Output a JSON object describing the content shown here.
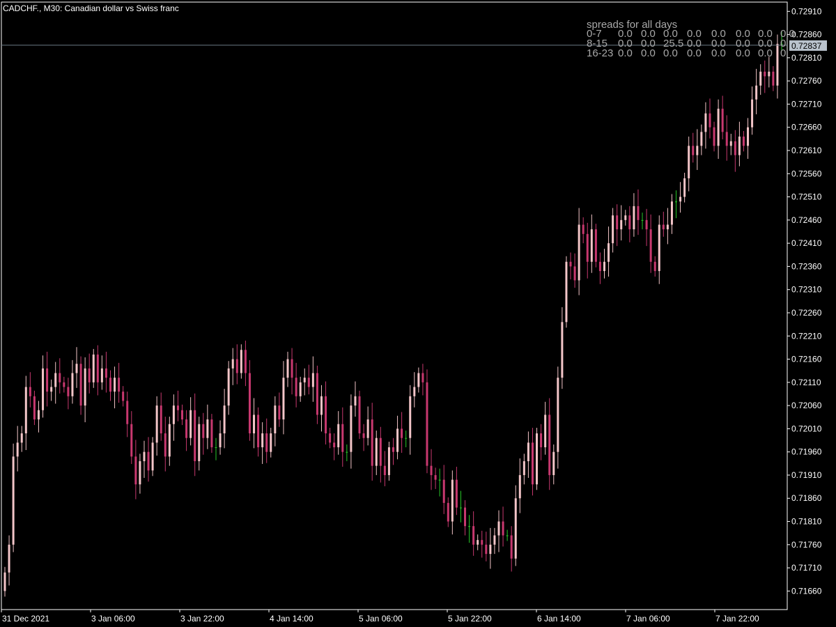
{
  "window": {
    "title": "CADCHF., M30:  Canadian dollar vs Swiss franc"
  },
  "colors": {
    "background": "#000000",
    "frame": "#ffffff",
    "bull": "#f3c5c8",
    "bear": "#c8386f",
    "neutral": "#28c828",
    "bid_line": "#6b7a86",
    "spread_text": "#a9a9a9",
    "badge_bg": "#b9c2cc"
  },
  "spreads": {
    "title": "spreads for all days",
    "rows": [
      {
        "label": "0-7",
        "values": [
          "0.0",
          "0.0",
          "0.0",
          "0.0",
          "0.0",
          "0.0",
          "0.0",
          "0.0"
        ]
      },
      {
        "label": "8-15",
        "values": [
          "0.0",
          "0.0",
          "25.5",
          "0.0",
          "0.0",
          "0.0",
          "0.0",
          "0"
        ]
      },
      {
        "label": "16-23",
        "values": [
          "0.0",
          "0.0",
          "0.0",
          "0.0",
          "0.0",
          "0.0",
          "0.0",
          "0"
        ]
      }
    ]
  },
  "current_price": "0.72837",
  "chart_data": {
    "type": "candlestick",
    "symbol": "CADCHF.",
    "timeframe": "M30",
    "ylim": [
      0.7162,
      0.7293
    ],
    "y_ticks": [
      "0.72910",
      "0.72860",
      "0.72810",
      "0.72760",
      "0.72710",
      "0.72660",
      "0.72610",
      "0.72560",
      "0.72510",
      "0.72460",
      "0.72410",
      "0.72360",
      "0.72310",
      "0.72260",
      "0.72210",
      "0.72160",
      "0.72110",
      "0.72060",
      "0.72010",
      "0.71960",
      "0.71910",
      "0.71860",
      "0.71810",
      "0.71760",
      "0.71710",
      "0.71660"
    ],
    "x_ticks": [
      "31 Dec 2021",
      "3 Jan 06:00",
      "3 Jan 22:00",
      "4 Jan 14:00",
      "5 Jan 06:00",
      "5 Jan 22:00",
      "6 Jan 14:00",
      "7 Jan 06:00",
      "7 Jan 22:00"
    ],
    "bid_line": 0.72837,
    "series": [
      {
        "name": "close",
        "values": [
          0.717,
          0.7176,
          0.7195,
          0.7198,
          0.72,
          0.721,
          0.7208,
          0.7203,
          0.7205,
          0.7214,
          0.7209,
          0.721,
          0.7213,
          0.7211,
          0.721,
          0.7208,
          0.7213,
          0.7215,
          0.7206,
          0.7214,
          0.7211,
          0.7217,
          0.7211,
          0.7214,
          0.7212,
          0.7209,
          0.7212,
          0.7209,
          0.7207,
          0.7202,
          0.7195,
          0.7189,
          0.7194,
          0.7196,
          0.7192,
          0.7198,
          0.7206,
          0.72,
          0.7195,
          0.7202,
          0.7206,
          0.7205,
          0.7203,
          0.7199,
          0.7205,
          0.7194,
          0.7202,
          0.7199,
          0.7203,
          0.7197,
          0.7197,
          0.72,
          0.7206,
          0.7214,
          0.7216,
          0.7213,
          0.7218,
          0.7213,
          0.72,
          0.7204,
          0.7197,
          0.72,
          0.7196,
          0.72,
          0.7206,
          0.7203,
          0.7212,
          0.7216,
          0.7212,
          0.7208,
          0.7211,
          0.7212,
          0.721,
          0.7213,
          0.7204,
          0.7208,
          0.72,
          0.7198,
          0.7197,
          0.7202,
          0.7196,
          0.7196,
          0.7206,
          0.7208,
          0.72,
          0.7199,
          0.7203,
          0.7193,
          0.7199,
          0.7193,
          0.7191,
          0.7197,
          0.7196,
          0.7201,
          0.7199,
          0.7199,
          0.7208,
          0.721,
          0.7213,
          0.7211,
          0.7193,
          0.7191,
          0.719,
          0.719,
          0.7185,
          0.7181,
          0.719,
          0.7184,
          0.7184,
          0.718,
          0.718,
          0.7176,
          0.7177,
          0.7176,
          0.7174,
          0.7176,
          0.7178,
          0.7181,
          0.7178,
          0.7178,
          0.7173,
          0.7186,
          0.7191,
          0.7194,
          0.7198,
          0.7189,
          0.72,
          0.7197,
          0.7204,
          0.7191,
          0.7196,
          0.7212,
          0.7224,
          0.7237,
          0.7236,
          0.7233,
          0.7245,
          0.7243,
          0.7237,
          0.7244,
          0.7237,
          0.7235,
          0.7237,
          0.7241,
          0.7247,
          0.7244,
          0.7246,
          0.7247,
          0.7244,
          0.7249,
          0.7246,
          0.7246,
          0.7244,
          0.7237,
          0.7235,
          0.7245,
          0.7244,
          0.7245,
          0.725,
          0.725,
          0.7251,
          0.7255,
          0.7262,
          0.726,
          0.7262,
          0.7265,
          0.7269,
          0.7266,
          0.7262,
          0.727,
          0.7265,
          0.7262,
          0.7263,
          0.726,
          0.7264,
          0.7262,
          0.7266,
          0.7272,
          0.7275,
          0.7278,
          0.7277,
          0.7278,
          0.7275,
          0.7284,
          0.7284
        ]
      }
    ]
  }
}
